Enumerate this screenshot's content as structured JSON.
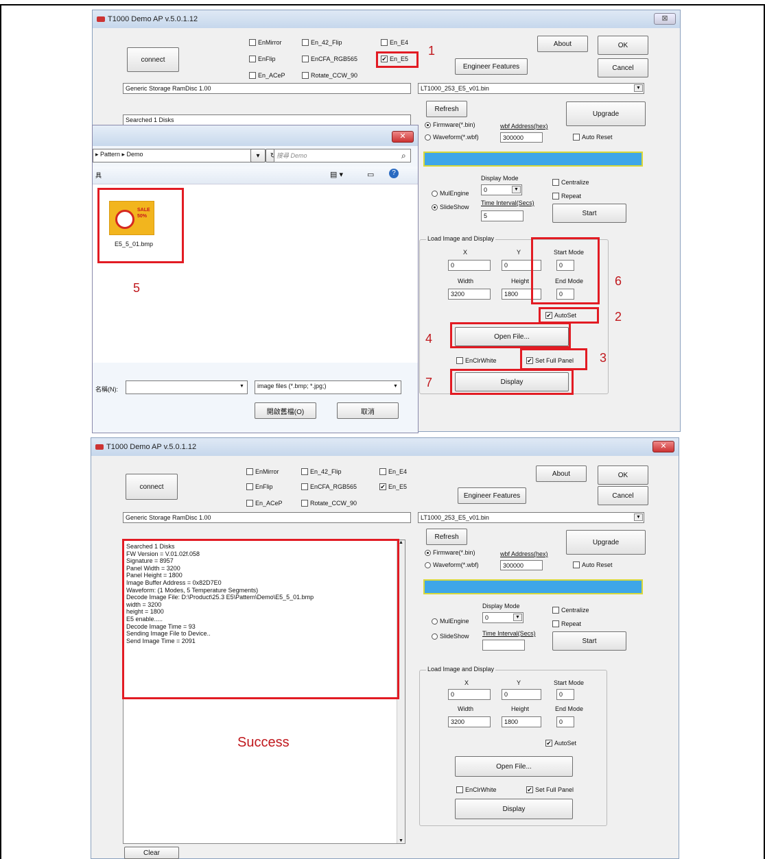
{
  "top_window": {
    "title": "T1000 Demo AP v.5.0.1.12",
    "connect_label": "connect",
    "checkboxes": [
      {
        "label": "EnMirror",
        "checked": false
      },
      {
        "label": "En_42_Flip",
        "checked": false
      },
      {
        "label": "En_E4",
        "checked": false
      },
      {
        "label": "EnFlip",
        "checked": false
      },
      {
        "label": "EnCFA_RGB565",
        "checked": false
      },
      {
        "label": "En_E5",
        "checked": true
      },
      {
        "label": "En_ACeP",
        "checked": false
      },
      {
        "label": "Rotate_CCW_90",
        "checked": false
      }
    ],
    "about_label": "About",
    "ok_label": "OK",
    "cancel_label": "Cancel",
    "engineer_label": "Engineer Features",
    "storage_field": "Generic Storage RamDisc 1.00",
    "firmware_file": "LT1000_253_E5_v01.bin",
    "refresh_label": "Refresh",
    "upgrade_label": "Upgrade",
    "searched_text": "Searched 1 Disks",
    "firmware_radio": "Firmware(*.bin)",
    "waveform_radio": "Waveform(*.wbf)",
    "wbf_address_label": "wbf Address(hex)",
    "wbf_address_value": "300000",
    "auto_reset_label": "Auto Reset",
    "display_mode_label": "Display Mode",
    "display_mode_value": "0",
    "multiengine_label": "MulEngine",
    "slideshow_label": "SlideShow",
    "time_interval_label": "Time Interval(Secs)",
    "time_interval_value": "5",
    "centralize_label": "Centralize",
    "repeat_label": "Repeat",
    "start_label": "Start",
    "load_group_title": "Load Image and Display",
    "x_label": "X",
    "y_label": "Y",
    "x_value": "0",
    "y_value": "0",
    "start_mode_label": "Start Mode",
    "start_mode_value": "0",
    "width_label": "Width",
    "height_label": "Height",
    "width_value": "3200",
    "height_value": "1800",
    "end_mode_label": "End Mode",
    "end_mode_value": "0",
    "autoset_label": "AutoSet",
    "open_file_label": "Open File...",
    "enclrwhite_label": "EnClrWhite",
    "set_full_panel_label": "Set Full Panel",
    "display_label": "Display"
  },
  "file_dialog": {
    "breadcrumb": "▸ Pattern ▸ Demo",
    "search_placeholder": "搜尋 Demo",
    "toolbar_left": "具",
    "file_name": "E5_5_01.bmp",
    "thumb_text": "SALE 50%",
    "filename_label": "名稱(N):",
    "filetype_value": "image files (*.bmp; *.jpg;)",
    "open_button": "開啟舊檔(O)",
    "cancel_button": "取消"
  },
  "annotations": {
    "n1": "1",
    "n2": "2",
    "n3": "3",
    "n4": "4",
    "n5": "5",
    "n6": "6",
    "n7": "7",
    "success": "Success"
  },
  "bottom_window": {
    "title": "T1000 Demo AP v.5.0.1.12",
    "clear_label": "Clear",
    "log_lines": [
      "Searched 1 Disks",
      "FW Version = V.01.02f.058",
      "Signature = 8957",
      "Panel Width = 3200",
      "Panel Height = 1800",
      "Image Buffer Address = 0x82D7E0",
      "Waveform: (1 Modes, 5 Temperature Segments)",
      "Decode Image File: D:\\Product\\25.3 E5\\Pattern\\Demo\\E5_5_01.bmp",
      "width = 3200",
      "height = 1800",
      "E5 enable.....",
      "Decode Image Time = 93",
      "Sending Image File to Device..",
      "Send Image Time = 2091"
    ],
    "time_interval_value": ""
  }
}
